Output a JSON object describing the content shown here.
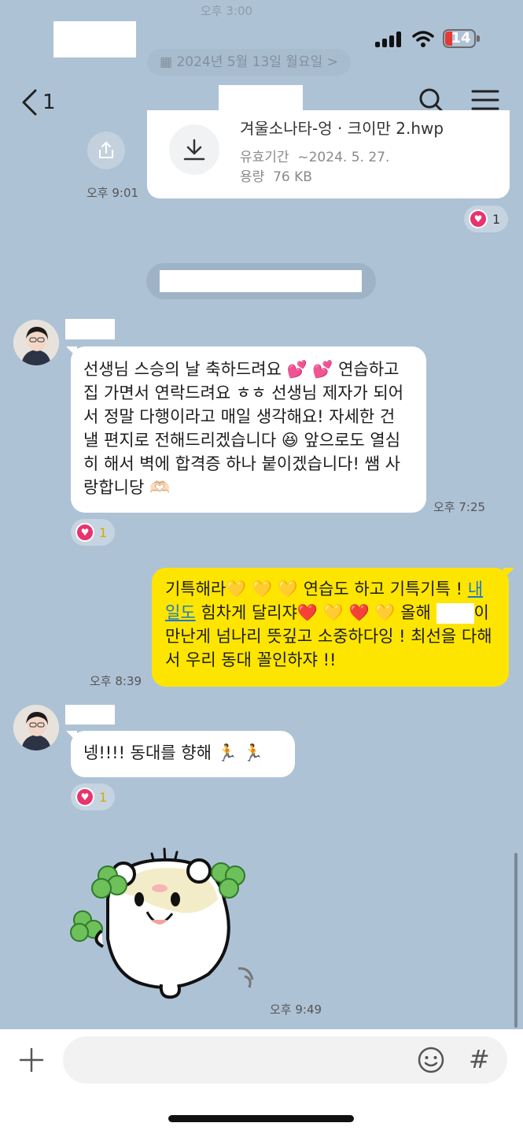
{
  "status_bar": {
    "battery_level": "14",
    "faded_prev_time": "오후 3:00"
  },
  "header": {
    "back_count": "1",
    "faded_date": "2024년 5월 13일 월요일 >"
  },
  "file_message": {
    "file_name": "겨울소나타-엉 · 크이만 2.hwp",
    "expiry_label": "유효기간",
    "expiry_value": "~2024. 5. 27.",
    "size_label": "용량",
    "size_value": "76 KB",
    "time": "오후 9:01",
    "reaction_count": "1"
  },
  "messages": [
    {
      "text": "선생님 스승의 날 축하드려요 💕 💕 연습하고 집 가면서 연락드려요 ㅎㅎ 선생님 제자가 되어서 정말 다행이라고 매일 생각해요! 자세한 건 낼 편지로 전해드리겠습니다 😆 앞으로도 열심히 해서 벽에 합격증 하나 붙이겠습니다! 쌤 사랑합니당 🫶🏻",
      "time": "오후 7:25",
      "reaction_count": "1"
    },
    {
      "text_before_link": "기특해라💛 💛 💛 연습도 하고 기특기특 ! ",
      "link_text": "내일도",
      "text_after_link": " 힘차게 달리쟈❤️ 💛 ❤️ 💛 올해 ",
      "text_end": "이 만난게 넘나리 뜻깊고 소중하다잉 ! 최선을 다해서 우리 동대 꼴인하쟈 !!",
      "time": "오후 8:39"
    },
    {
      "text": "넹!!!! 동대를 향해 🏃 🏃",
      "reaction_count": "1"
    },
    {
      "sticker": "hamster-with-clover",
      "time": "오후 9:49"
    }
  ],
  "composer": {
    "placeholder": ""
  },
  "colors": {
    "background": "#aec2d6",
    "my_bubble": "#fee500",
    "their_bubble": "#ffffff",
    "heart": "#e8336d"
  }
}
